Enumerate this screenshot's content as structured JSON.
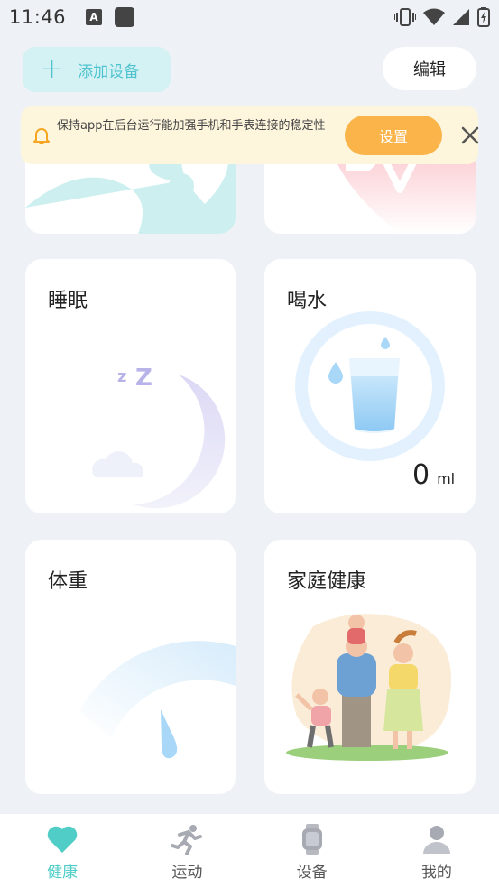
{
  "status_bar": {
    "time": "11:46",
    "a_icon_letter": "A"
  },
  "header": {
    "add_device_label": "添加设备",
    "edit_label": "编辑"
  },
  "notice": {
    "text": "保持app在后台运行能加强手机和手表连接的稳定性",
    "button_label": "设置"
  },
  "cards": {
    "sleep": {
      "title": "睡眠"
    },
    "water": {
      "title": "喝水",
      "amount": "0",
      "unit": "ml"
    },
    "weight": {
      "title": "体重"
    },
    "family": {
      "title": "家庭健康"
    }
  },
  "bottom_nav": {
    "items": [
      {
        "label": "健康",
        "icon": "heart-icon",
        "active": true
      },
      {
        "label": "运动",
        "icon": "runner-icon",
        "active": false
      },
      {
        "label": "设备",
        "icon": "watch-icon",
        "active": false
      },
      {
        "label": "我的",
        "icon": "user-icon",
        "active": false
      }
    ]
  },
  "colors": {
    "accent": "#4fcdc6",
    "notice_button": "#fbb44a",
    "notice_background": "#fdf6dd",
    "add_device_background": "#d4f1f4"
  }
}
